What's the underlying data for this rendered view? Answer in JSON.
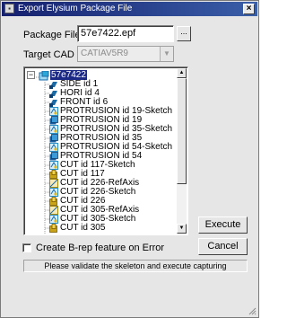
{
  "window": {
    "title": "Export Elysium Package File",
    "close_glyph": "×"
  },
  "package": {
    "label": "Package File",
    "value": "57e7422.epf",
    "browse_label": "..."
  },
  "cad": {
    "label": "Target CAD",
    "value": "CATIAV5R9"
  },
  "tree": {
    "expander": "−",
    "root": {
      "label": "57e7422",
      "icon": "model-icon"
    },
    "items": [
      {
        "label": "SIDE id 1",
        "icon": "plane-icon"
      },
      {
        "label": "HORI id 4",
        "icon": "plane-icon"
      },
      {
        "label": "FRONT id 6",
        "icon": "plane-icon"
      },
      {
        "label": "PROTRUSION id 19-Sketch",
        "icon": "sketch-icon"
      },
      {
        "label": "PROTRUSION id 19",
        "icon": "protrusion-icon"
      },
      {
        "label": "PROTRUSION id 35-Sketch",
        "icon": "sketch-icon"
      },
      {
        "label": "PROTRUSION id 35",
        "icon": "protrusion-icon"
      },
      {
        "label": "PROTRUSION id 54-Sketch",
        "icon": "sketch-icon"
      },
      {
        "label": "PROTRUSION id 54",
        "icon": "protrusion-icon"
      },
      {
        "label": "CUT id 117-Sketch",
        "icon": "sketch-icon"
      },
      {
        "label": "CUT id 117",
        "icon": "cut-icon"
      },
      {
        "label": "CUT id 226-RefAxis",
        "icon": "axis-icon"
      },
      {
        "label": "CUT id 226-Sketch",
        "icon": "sketch-icon"
      },
      {
        "label": "CUT id 226",
        "icon": "cut-icon"
      },
      {
        "label": "CUT id 305-RefAxis",
        "icon": "axis-icon"
      },
      {
        "label": "CUT id 305-Sketch",
        "icon": "sketch-icon"
      },
      {
        "label": "CUT id 305",
        "icon": "cut-icon"
      }
    ],
    "scroll_up_glyph": "▲",
    "scroll_down_glyph": "▼"
  },
  "buttons": {
    "execute": "Execute",
    "cancel": "Cancel"
  },
  "option": {
    "label": "Create B-rep feature on Error",
    "checked": false
  },
  "status": "Please validate the skeleton and execute capturing",
  "colors": {
    "titlebar_start": "#15206e",
    "titlebar_end": "#3a5ea8",
    "selection": "#1c2a86",
    "plane_icon": "#1a6aa6",
    "sketch_icon": "#2a8fc6",
    "protrusion_icon": "#1b5fa0",
    "cut_icon": "#c9a31a"
  }
}
